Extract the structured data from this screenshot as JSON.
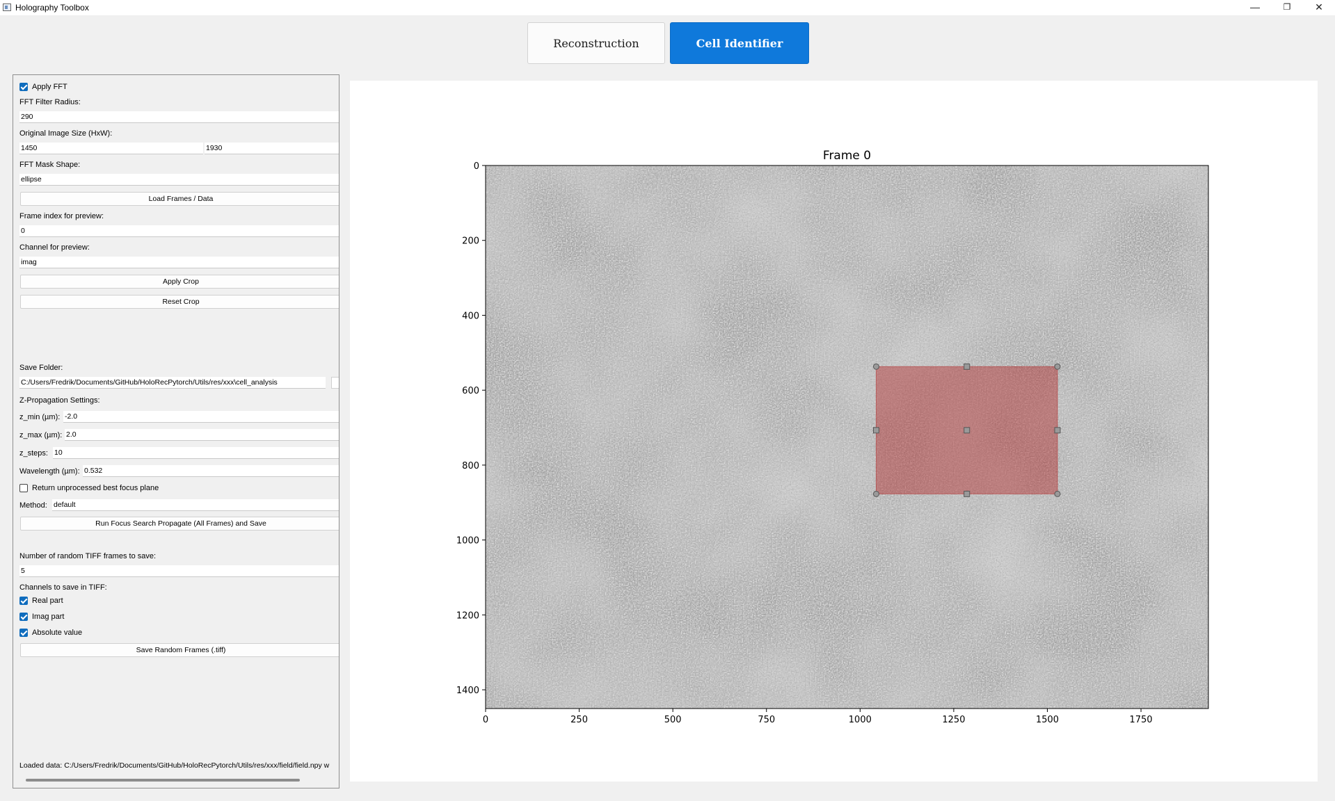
{
  "window": {
    "title": "Holography Toolbox",
    "min_glyph": "—",
    "max_glyph": "❐",
    "close_glyph": "✕"
  },
  "tabs": [
    {
      "label": "Reconstruction",
      "active": false
    },
    {
      "label": "Cell Identifier",
      "active": true
    }
  ],
  "left": {
    "apply_fft": {
      "label": "Apply FFT",
      "checked": true
    },
    "fft_filter_radius": {
      "label": "FFT Filter Radius:",
      "value": "290"
    },
    "original_size": {
      "label": "Original Image Size (HxW):",
      "h": "1450",
      "w": "1930"
    },
    "fft_mask_shape": {
      "label": "FFT Mask Shape:",
      "value": "ellipse"
    },
    "load_button": "Load Frames / Data",
    "frame_index": {
      "label": "Frame index for preview:",
      "value": "0"
    },
    "channel": {
      "label": "Channel for preview:",
      "value": "imag"
    },
    "apply_crop_button": "Apply Crop",
    "reset_crop_button": "Reset Crop",
    "save_folder": {
      "label": "Save Folder:",
      "value": "C:/Users/Fredrik/Documents/GitHub/HoloRecPytorch/Utils/res/xxx\\cell_analysis"
    },
    "zprop_label": "Z-Propagation Settings:",
    "z_min": {
      "label": "z_min (µm):",
      "value": "-2.0"
    },
    "z_max": {
      "label": "z_max (µm):",
      "value": "2.0"
    },
    "z_steps": {
      "label": "z_steps:",
      "value": "10"
    },
    "wavelength": {
      "label": "Wavelength (µm):",
      "value": "0.532"
    },
    "return_unprocessed": {
      "label": "Return unprocessed best focus plane",
      "checked": false
    },
    "method": {
      "label": "Method:",
      "value": "default"
    },
    "run_button": "Run Focus Search  Propagate (All Frames) and Save",
    "num_random": {
      "label": "Number of random TIFF frames to save:",
      "value": "5"
    },
    "channels_label": "Channels to save in TIFF:",
    "real_part": {
      "label": "Real part",
      "checked": true
    },
    "imag_part": {
      "label": "Imag part",
      "checked": true
    },
    "absolute_value": {
      "label": "Absolute value",
      "checked": true
    },
    "save_random_button": "Save Random Frames (.tiff)",
    "loaded_data": "Loaded data: C:/Users/Fredrik/Documents/GitHub/HoloRecPytorch/Utils/res/xxx/field/field.npy w"
  },
  "plot": {
    "title": "Frame 0",
    "xticks": [
      "0",
      "250",
      "500",
      "750",
      "1000",
      "1250",
      "1500",
      "1750"
    ],
    "yticks": [
      "0",
      "200",
      "400",
      "600",
      "800",
      "1000",
      "1200",
      "1400"
    ],
    "xlim": [
      0,
      1930
    ],
    "ylim": [
      0,
      1450
    ],
    "selection": {
      "x0": 1043,
      "x1": 1527,
      "y0": 537,
      "y1": 877,
      "color": "#b02020"
    }
  }
}
